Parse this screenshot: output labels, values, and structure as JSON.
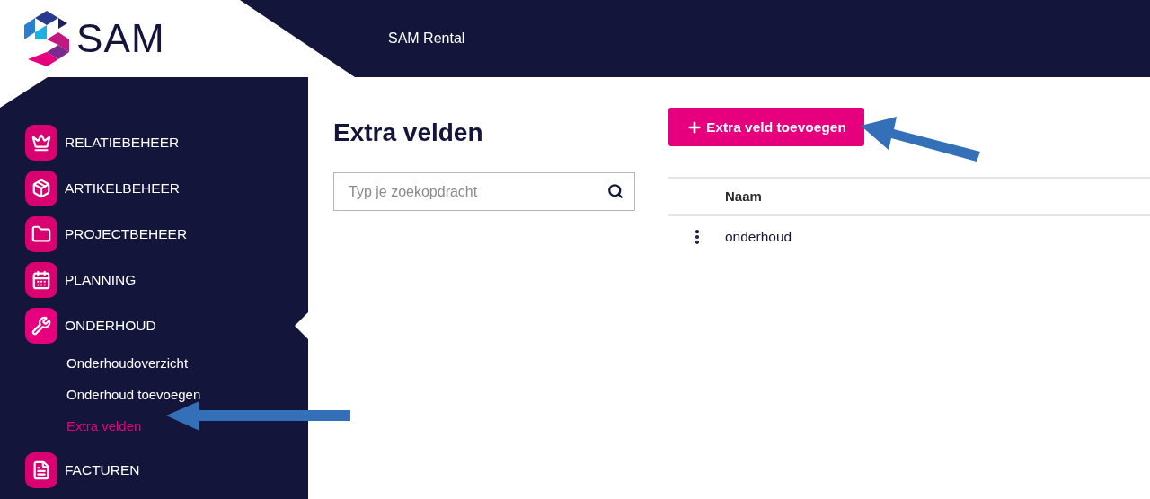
{
  "header": {
    "logo_text": "SAM",
    "app_title": "SAM Rental"
  },
  "sidebar": {
    "items": [
      {
        "label": "RELATIEBEHEER",
        "selected": false
      },
      {
        "label": "ARTIKELBEHEER",
        "selected": false
      },
      {
        "label": "PROJECTBEHEER",
        "selected": false
      },
      {
        "label": "PLANNING",
        "selected": false
      },
      {
        "label": "ONDERHOUD",
        "selected": true,
        "children": [
          {
            "label": "Onderhoudoverzicht",
            "selected": false
          },
          {
            "label": "Onderhoud toevoegen",
            "selected": false
          },
          {
            "label": "Extra velden",
            "selected": true
          }
        ]
      },
      {
        "label": "FACTUREN",
        "selected": false
      }
    ]
  },
  "page": {
    "title": "Extra velden",
    "search": {
      "placeholder": "Typ je zoekopdracht"
    },
    "add_button": "Extra veld toevoegen",
    "table": {
      "columns": [
        "Naam"
      ],
      "rows": [
        [
          "onderhoud"
        ]
      ]
    }
  }
}
